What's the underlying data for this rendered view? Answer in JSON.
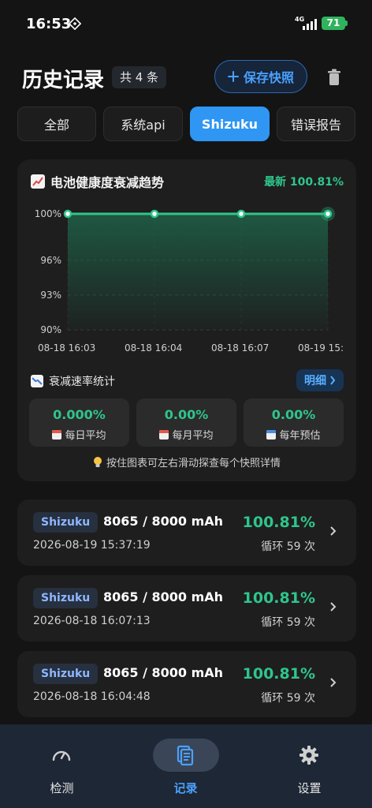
{
  "status_bar": {
    "time": "16:53",
    "network": "4G",
    "battery": "71"
  },
  "header": {
    "title": "历史记录",
    "count": "共 4 条",
    "save_label": "保存快照"
  },
  "tabs": [
    {
      "label": "全部"
    },
    {
      "label": "系统api"
    },
    {
      "label": "Shizuku",
      "active": true
    },
    {
      "label": "错误报告"
    }
  ],
  "trend_card": {
    "title": "电池健康度衰减趋势",
    "latest": "最新 100.81%",
    "rate_title": "衰减速率统计",
    "detail_label": "明细",
    "stats": [
      {
        "value": "0.000%",
        "label": "每日平均"
      },
      {
        "value": "0.00%",
        "label": "每月平均"
      },
      {
        "value": "0.00%",
        "label": "每年预估"
      }
    ],
    "hint": "按住图表可左右滑动探查每个快照详情"
  },
  "chart_data": {
    "type": "area",
    "y_ticks": [
      "100%",
      "96%",
      "93%",
      "90%"
    ],
    "ylim": [
      90,
      100
    ],
    "x": [
      "08-18 16:03",
      "08-18 16:04",
      "08-18 16:07",
      "08-19 15:"
    ],
    "series": [
      {
        "values": [
          100,
          100,
          100,
          100
        ]
      }
    ],
    "line_color": "#2fc58c",
    "grid": true
  },
  "records": [
    {
      "source": "Shizuku",
      "capacity": "8065 / 8000 mAh",
      "time": "2026-08-19 15:37:19",
      "health": "100.81%",
      "cycles": "循环 59 次"
    },
    {
      "source": "Shizuku",
      "capacity": "8065 / 8000 mAh",
      "time": "2026-08-18 16:07:13",
      "health": "100.81%",
      "cycles": "循环 59 次"
    },
    {
      "source": "Shizuku",
      "capacity": "8065 / 8000 mAh",
      "time": "2026-08-18 16:04:48",
      "health": "100.81%",
      "cycles": "循环 59 次"
    }
  ],
  "nav": [
    {
      "label": "检测",
      "icon": "gauge-icon"
    },
    {
      "label": "记录",
      "icon": "records-icon",
      "active": true
    },
    {
      "label": "设置",
      "icon": "gear-icon"
    }
  ],
  "colors": {
    "accent": "#2f96f3",
    "health_green": "#2fc58c",
    "battery": "#2fb35d"
  }
}
